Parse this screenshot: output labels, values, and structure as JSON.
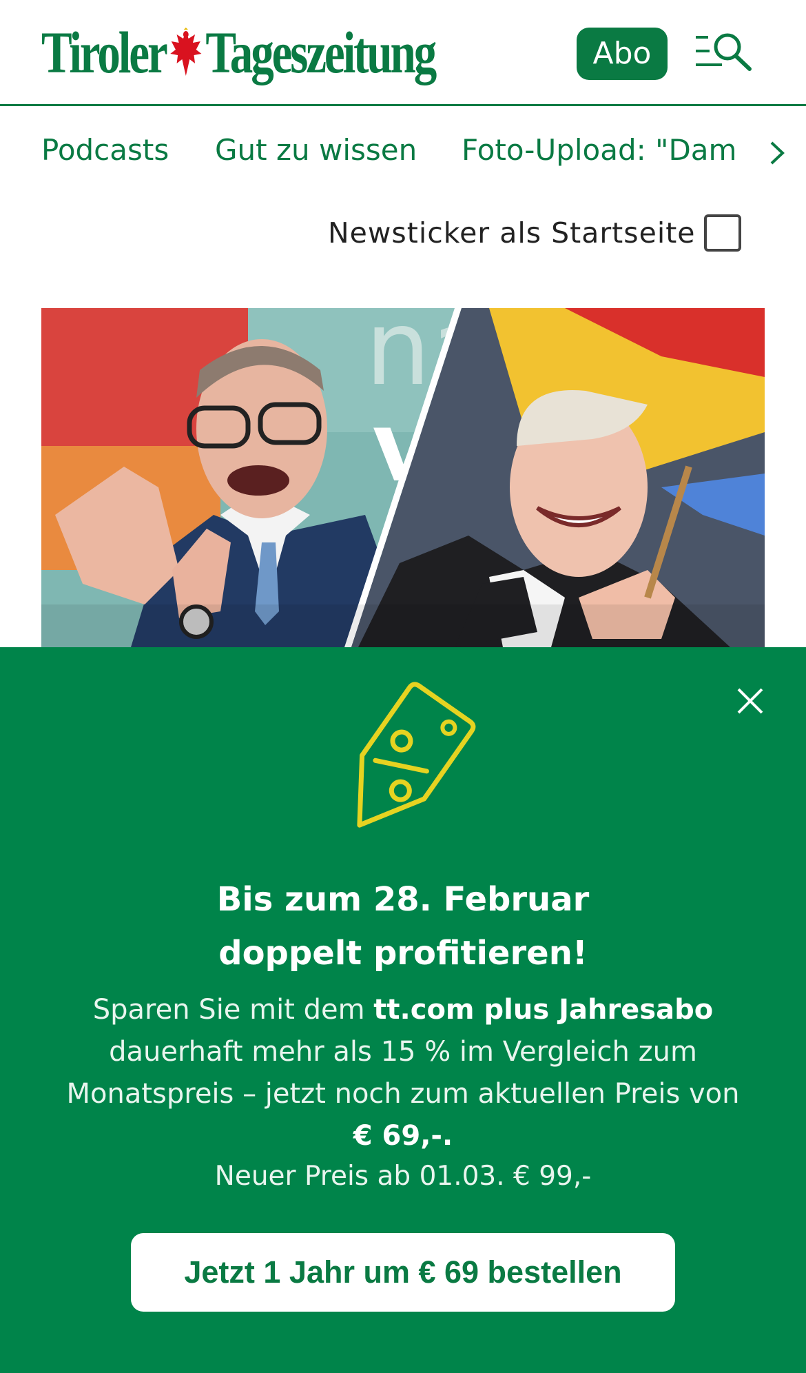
{
  "header": {
    "logo_left": "Tiroler",
    "logo_right": "Tageszeitung",
    "abo_label": "Abo"
  },
  "nav": {
    "items": [
      {
        "label": "Podcasts"
      },
      {
        "label": "Gut zu wissen"
      },
      {
        "label": "Foto-Upload: \"Damals"
      }
    ]
  },
  "ticker": {
    "label": "Newsticker als Startseite",
    "checked": false
  },
  "promo": {
    "title_line1": "Bis zum 28. Februar",
    "title_line2": "doppelt profitieren!",
    "body_prefix": "Sparen Sie mit dem ",
    "body_bold": "tt.com plus Jahresabo",
    "body_middle": " dauerhaft mehr als 15 % im Vergleich zum Monatspreis – jetzt noch zum aktuellen Preis von ",
    "body_price": "€ 69,-.",
    "note": "Neuer Preis ab 01.03. € 99,-",
    "cta_label": "Jetzt 1 Jahr um € 69 bestellen"
  },
  "colors": {
    "brand_green": "#0a7a43",
    "promo_green": "#00844a",
    "tag_yellow": "#e6d321"
  }
}
